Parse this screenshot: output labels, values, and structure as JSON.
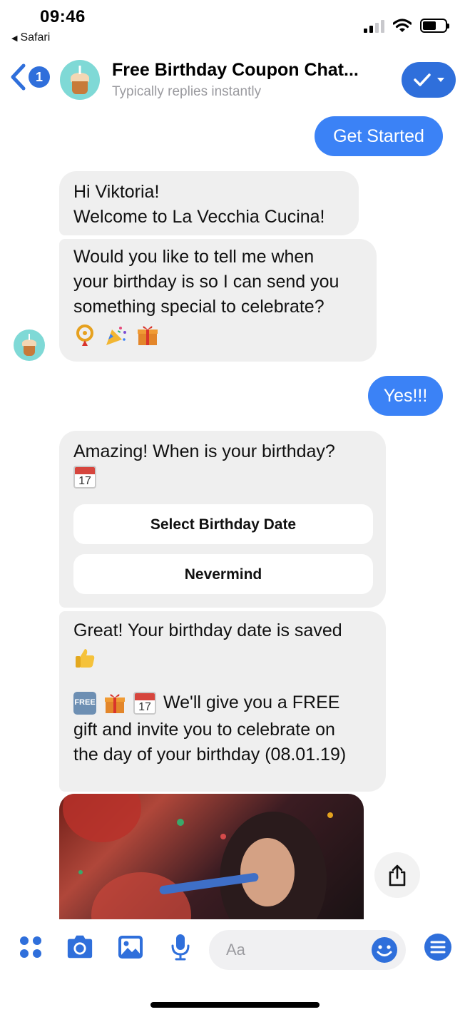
{
  "status_bar": {
    "time": "09:46",
    "back_app": "Safari"
  },
  "header": {
    "back_count": "1",
    "title": "Free Birthday Coupon Chat...",
    "subtitle": "Typically replies instantly"
  },
  "messages": {
    "get_started": "Get Started",
    "greeting_line1": "Hi Viktoria!",
    "greeting_line2": "Welcome to La Vecchia Cucina!",
    "ask_line1": "Would you like to tell me when",
    "ask_line2": "your birthday is so I can send you",
    "ask_line3": "something special to celebrate?",
    "yes": "Yes!!!",
    "when_line": "Amazing! When is your birthday?",
    "calendar_day": "17",
    "select_date_button": "Select Birthday Date",
    "nevermind_button": "Nevermind",
    "saved_line": "Great! Your birthday date is saved",
    "free_badge": "FREE",
    "gift_line1": "We'll give you a FREE",
    "gift_line2": "gift and invite you to celebrate on",
    "gift_line3": "the day of your birthday (08.01.19)"
  },
  "composer": {
    "placeholder": "Aa"
  },
  "icons": [
    "back-chevron-icon",
    "checkmark-icon",
    "horn-icon",
    "party-popper-icon",
    "gift-icon",
    "calendar-icon",
    "thumbs-up-icon",
    "share-icon",
    "grid-icon",
    "camera-icon",
    "image-icon",
    "microphone-icon",
    "smiley-icon",
    "menu-icon"
  ],
  "colors": {
    "accent": "#2f6fdb",
    "outgoing_bubble": "#3b82f6",
    "incoming_bubble": "#efefef"
  }
}
